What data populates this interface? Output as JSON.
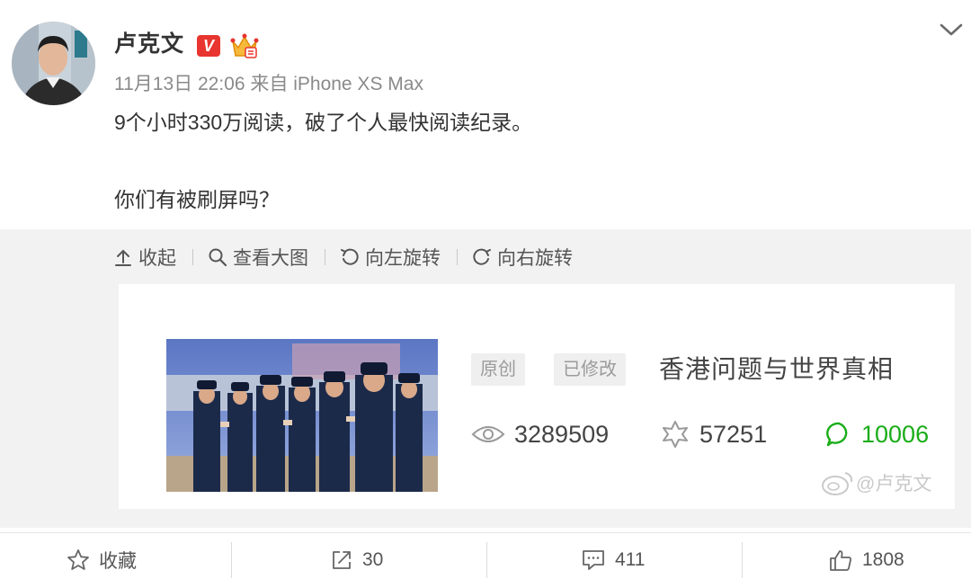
{
  "post": {
    "author": "卢克文",
    "verified_badge": "V",
    "meta": "11月13日 22:06 来自 iPhone XS Max",
    "text_line1": "9个小时330万阅读，破了个人最快阅读纪录。",
    "text_line2": "你们有被刷屏吗？"
  },
  "image_toolbar": {
    "collapse": "收起",
    "view_large": "查看大图",
    "rotate_left": "向左旋转",
    "rotate_right": "向右旋转"
  },
  "article": {
    "tag_original": "原创",
    "tag_modified": "已修改",
    "title": "香港问题与世界真相",
    "views": "3289509",
    "likes": "57251",
    "comments": "10006",
    "watermark": "@卢克文"
  },
  "actions": {
    "favorite": "收藏",
    "repost": "30",
    "comment": "411",
    "like": "1808"
  },
  "colors": {
    "verified_red": "#e8352f",
    "comment_green": "#1aad19",
    "text_gray": "#8a8a8a",
    "panel_gray": "#f2f2f2"
  },
  "icons": [
    "chevron-down-icon",
    "collapse-icon",
    "search-icon",
    "rotate-left-icon",
    "rotate-right-icon",
    "eye-icon",
    "like-icon",
    "comment-icon",
    "weibo-icon",
    "star-icon",
    "share-icon",
    "comment-bubble-icon",
    "thumbs-up-icon"
  ]
}
